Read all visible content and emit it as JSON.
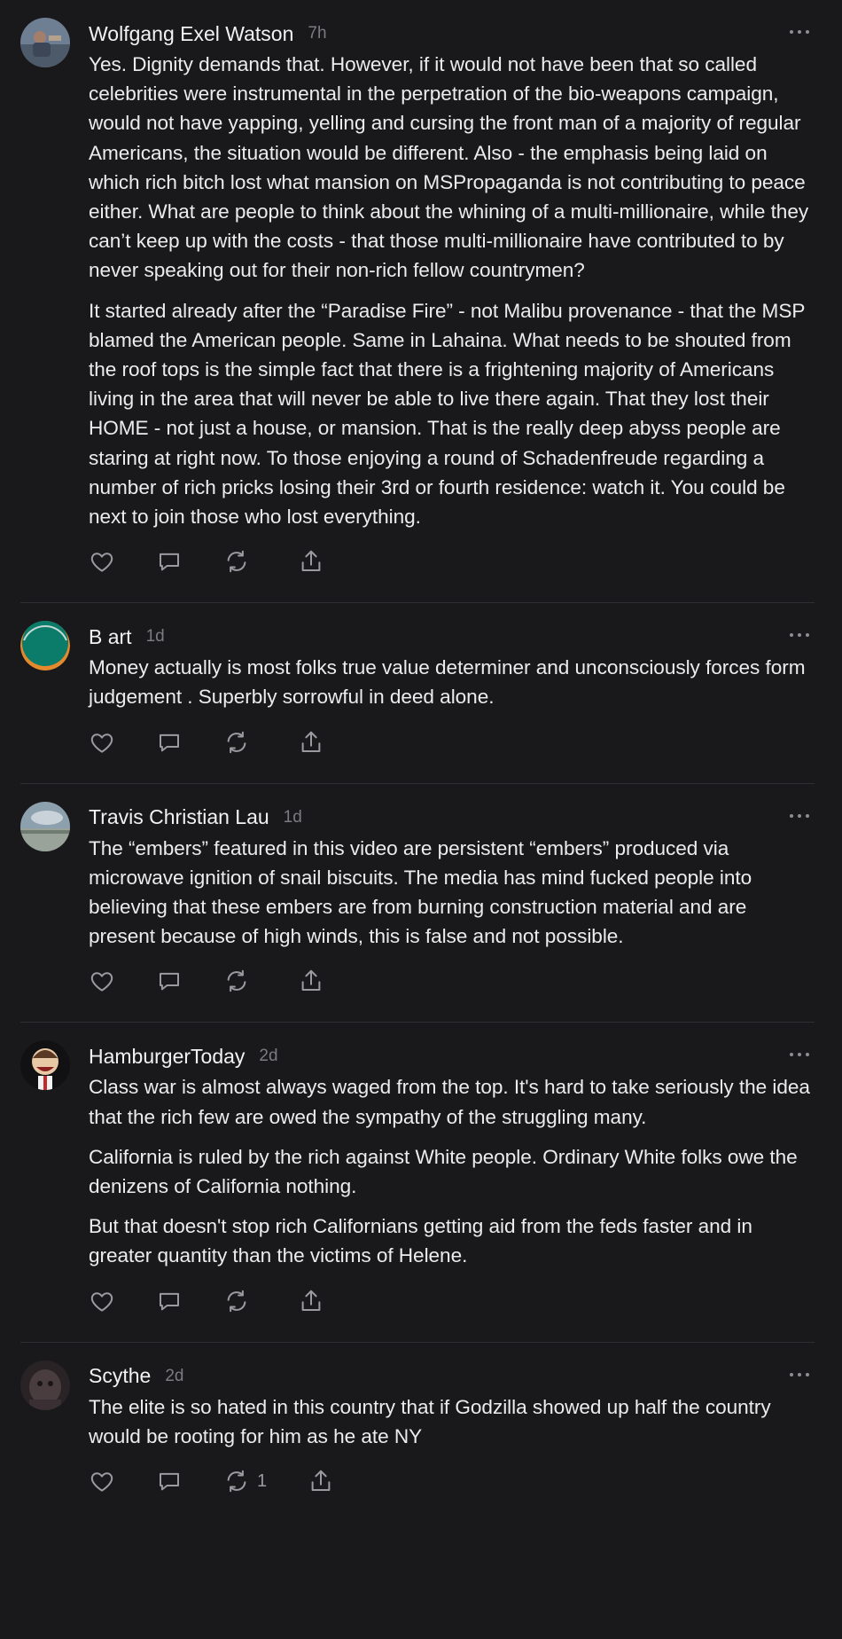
{
  "comments": [
    {
      "author": "Wolfgang Exel Watson",
      "time": "7h",
      "paragraphs": [
        "Yes. Dignity demands that. However, if it would not have been that so called celebrities were instrumental in the perpetration of the bio-weapons campaign, would not have yapping, yelling and cursing the front man of a majority of regular Americans, the situation would be different. Also - the emphasis being laid on which rich bitch lost what mansion on MSPropaganda is not contributing to peace either. What are people to think about the whining of a multi-millionaire, while they can’t keep up with the costs - that those multi-millionaire have contributed to by never speaking out for their non-rich fellow countrymen?",
        "It started already after the “Paradise Fire” - not Malibu provenance - that the MSP blamed the American people. Same in Lahaina. What needs to be shouted from the roof tops is the simple fact that there is a frightening majority of Americans living in the area that will never be able to live there again. That they lost their HOME - not just a house, or mansion. That is the really deep abyss people are staring at right now. To those enjoying a round of Schadenfreude regarding a number of rich pricks losing their 3rd or fourth residence: watch it. You could be next to join those who lost everything."
      ],
      "restack_count": ""
    },
    {
      "author": "B art",
      "time": "1d",
      "paragraphs": [
        "Money actually is most folks true value determiner and unconsciously forces form judgement . Superbly sorrowful in deed alone."
      ],
      "restack_count": ""
    },
    {
      "author": "Travis Christian Lau",
      "time": "1d",
      "paragraphs": [
        "The “embers” featured in this video are persistent “embers” produced via microwave ignition of snail biscuits. The media has mind fucked people into believing that these embers are from burning construction material and are present because of high winds, this is false and not possible."
      ],
      "restack_count": ""
    },
    {
      "author": "HamburgerToday",
      "time": "2d",
      "paragraphs": [
        "Class war is almost always waged from the top. It's hard to take seriously the idea that the rich few are owed the sympathy of the struggling many.",
        "California is ruled by the rich against White people. Ordinary White folks owe the denizens of California nothing.",
        "But that doesn't stop rich Californians getting aid from the feds faster and in greater quantity than the victims of Helene."
      ],
      "restack_count": ""
    },
    {
      "author": "Scythe",
      "time": "2d",
      "paragraphs": [
        "The elite is so hated in this country that if Godzilla showed up half the country would be rooting for him as he ate NY"
      ],
      "restack_count": "1"
    }
  ],
  "icons": {
    "like": "heart-icon",
    "reply": "comment-bubble-icon",
    "restack": "restack-icon",
    "share": "share-icon",
    "more": "more-dots-icon"
  },
  "colors": {
    "background": "#19191c",
    "text": "#ececec",
    "muted": "#7b7b80",
    "icon": "#9a9aa0",
    "divider": "#2e2e33"
  }
}
